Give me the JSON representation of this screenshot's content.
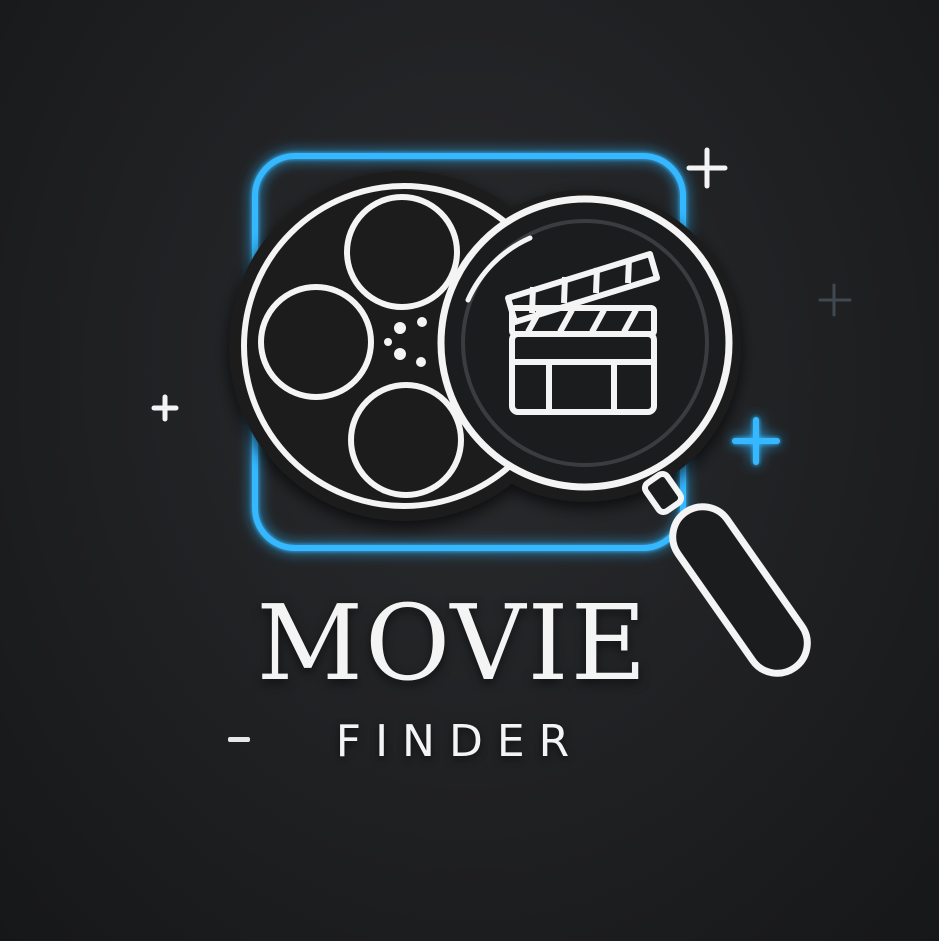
{
  "logo": {
    "title": "MOVIE",
    "subtitle": "FINDER"
  },
  "icons": {
    "frame": "glow-frame-icon",
    "reel": "film-reel-icon",
    "magnifier": "magnifying-glass-icon",
    "clapper": "clapperboard-icon",
    "sparkles": "sparkle-icon"
  },
  "colors": {
    "background": "#1c1d1f",
    "glow_blue": "#35b8ff",
    "line_white": "#f4f4f4"
  }
}
